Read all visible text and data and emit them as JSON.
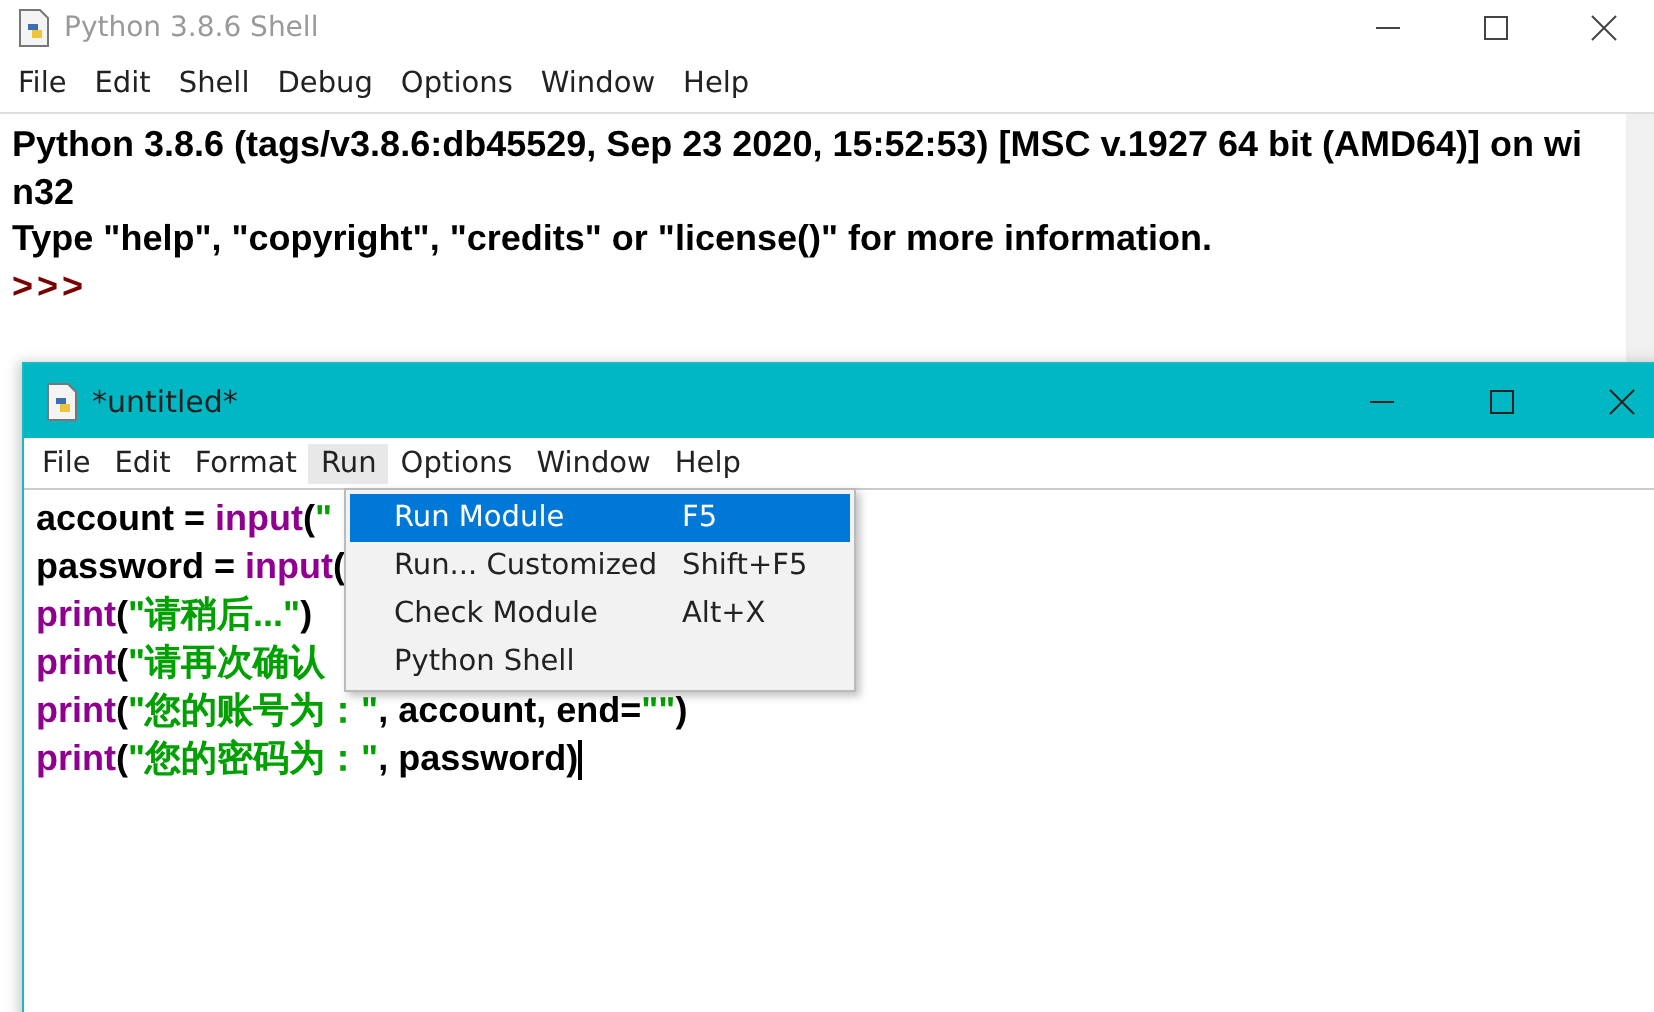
{
  "shell": {
    "title": "Python 3.8.6 Shell",
    "menu": [
      "File",
      "Edit",
      "Shell",
      "Debug",
      "Options",
      "Window",
      "Help"
    ],
    "output": [
      {
        "kind": "info",
        "text": "Python 3.8.6 (tags/v3.8.6:db45529, Sep 23 2020, 15:52:53) [MSC v.1927 64 bit (AMD64)] on wi"
      },
      {
        "kind": "info",
        "text": "n32"
      },
      {
        "kind": "info",
        "text": "Type \"help\", \"copyright\", \"credits\" or \"license()\" for more information."
      },
      {
        "kind": "prompt",
        "text": ">>>"
      }
    ]
  },
  "editor": {
    "title": "*untitled*",
    "menu": [
      {
        "label": "File",
        "selected": false
      },
      {
        "label": "Edit",
        "selected": false
      },
      {
        "label": "Format",
        "selected": false
      },
      {
        "label": "Run",
        "selected": true
      },
      {
        "label": "Options",
        "selected": false
      },
      {
        "label": "Window",
        "selected": false
      },
      {
        "label": "Help",
        "selected": false
      }
    ],
    "code": [
      [
        {
          "kind": "plain",
          "text": "account = "
        },
        {
          "kind": "builtin",
          "text": "input"
        },
        {
          "kind": "plain",
          "text": "("
        },
        {
          "kind": "string",
          "text": "\""
        }
      ],
      [
        {
          "kind": "plain",
          "text": "password = "
        },
        {
          "kind": "builtin",
          "text": "input"
        },
        {
          "kind": "plain",
          "text": "("
        }
      ],
      [
        {
          "kind": "builtin",
          "text": "print"
        },
        {
          "kind": "plain",
          "text": "("
        },
        {
          "kind": "string",
          "text": "\"请稍后...\""
        },
        {
          "kind": "plain",
          "text": ")"
        }
      ],
      [
        {
          "kind": "builtin",
          "text": "print"
        },
        {
          "kind": "plain",
          "text": "("
        },
        {
          "kind": "string",
          "text": "\"请再次确认"
        }
      ],
      [
        {
          "kind": "builtin",
          "text": "print"
        },
        {
          "kind": "plain",
          "text": "("
        },
        {
          "kind": "string",
          "text": "\"您的账号为：\""
        },
        {
          "kind": "plain",
          "text": ", account, end="
        },
        {
          "kind": "string",
          "text": "\"\""
        },
        {
          "kind": "plain",
          "text": ")"
        }
      ],
      [
        {
          "kind": "builtin",
          "text": "print"
        },
        {
          "kind": "plain",
          "text": "("
        },
        {
          "kind": "string",
          "text": "\"您的密码为：\""
        },
        {
          "kind": "plain",
          "text": ", password)"
        }
      ]
    ],
    "run_menu": [
      {
        "label": "Run Module",
        "shortcut": "F5",
        "selected": true
      },
      {
        "label": "Run... Customized",
        "shortcut": "Shift+F5",
        "selected": false
      },
      {
        "label": "Check Module",
        "shortcut": "Alt+X",
        "selected": false
      },
      {
        "label": "Python Shell",
        "selected": false
      }
    ]
  }
}
